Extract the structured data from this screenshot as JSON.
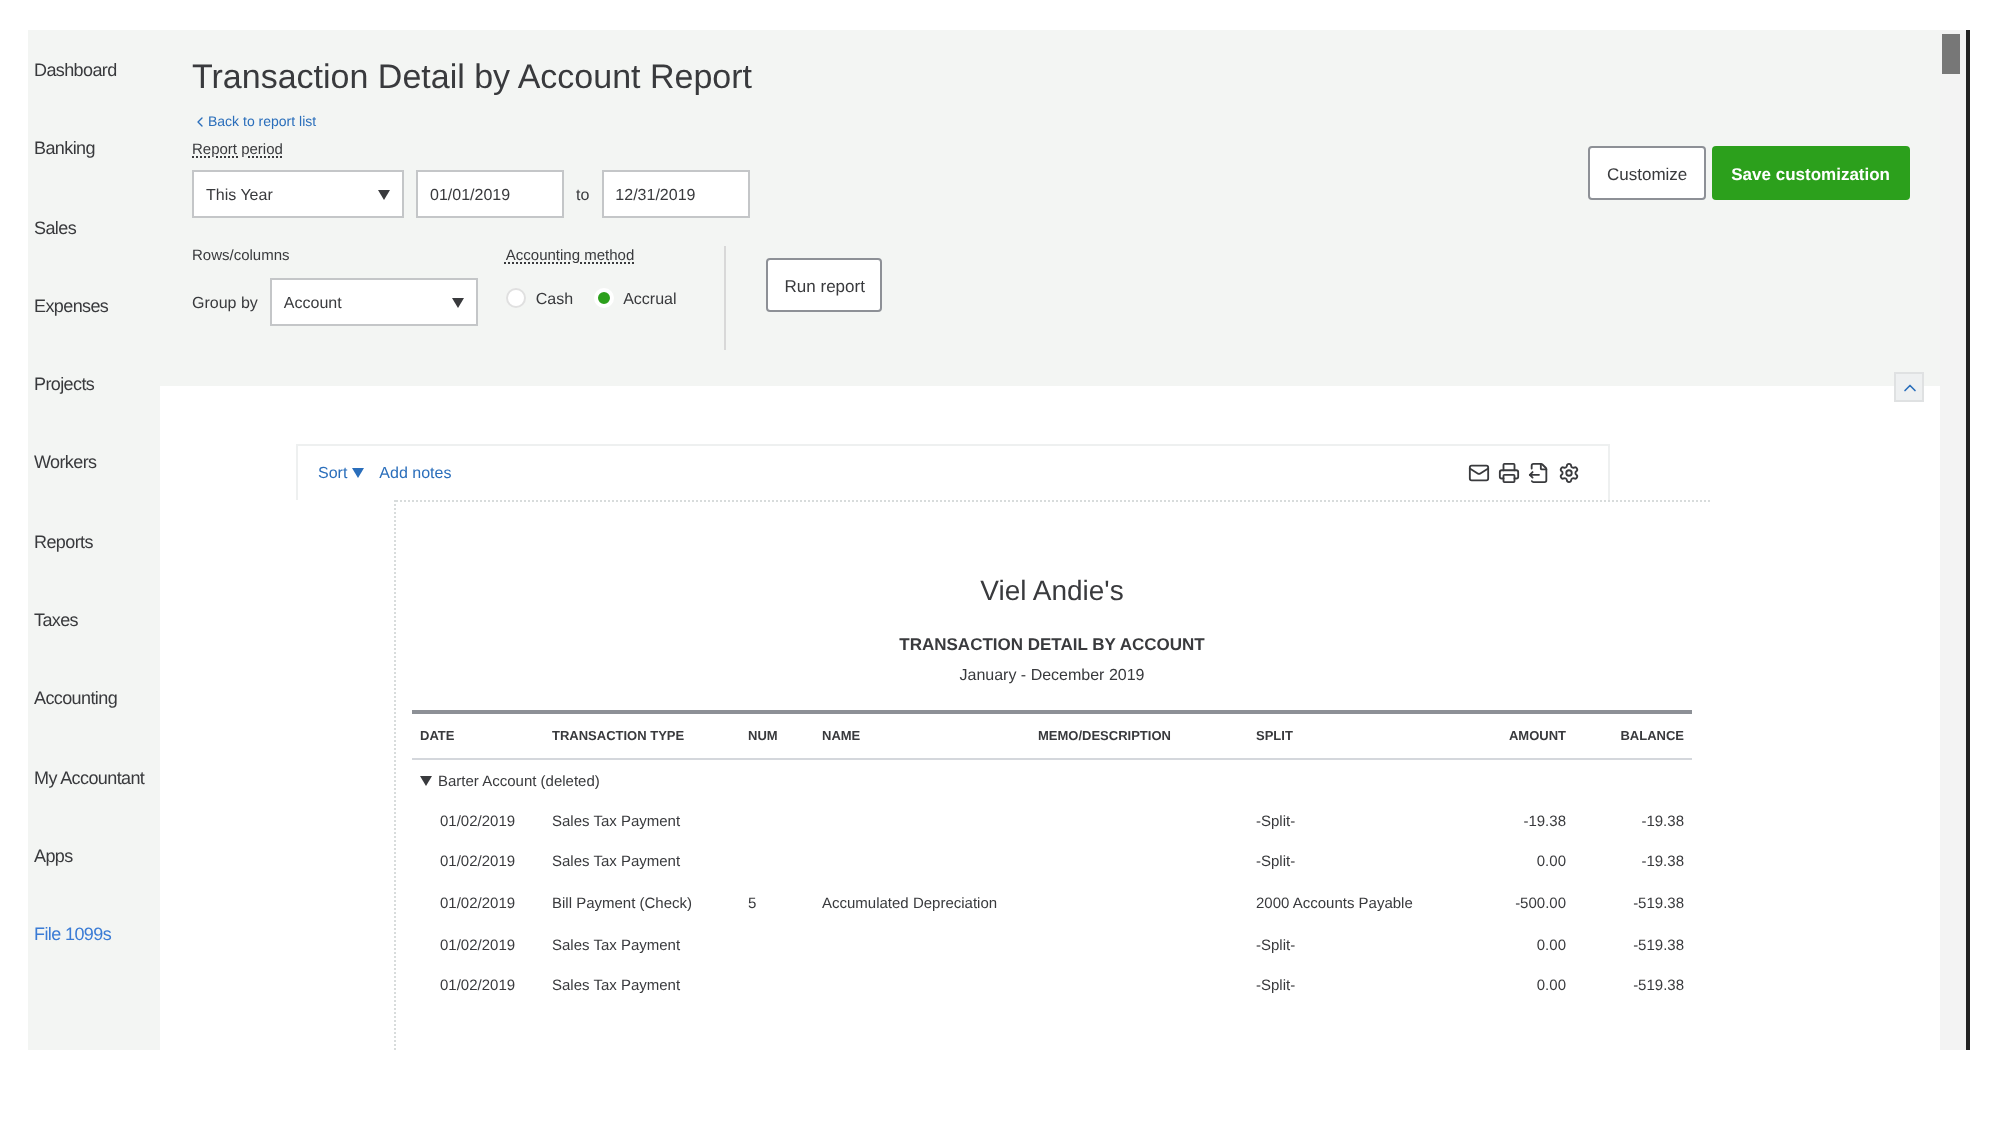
{
  "sidebar": {
    "items": [
      {
        "label": "Dashboard",
        "kind": "nav"
      },
      {
        "label": "Banking",
        "kind": "nav"
      },
      {
        "label": "Sales",
        "kind": "nav"
      },
      {
        "label": "Expenses",
        "kind": "nav"
      },
      {
        "label": "Projects",
        "kind": "nav"
      },
      {
        "label": "Workers",
        "kind": "nav"
      },
      {
        "label": "Reports",
        "kind": "nav"
      },
      {
        "label": "Taxes",
        "kind": "nav"
      },
      {
        "label": "Accounting",
        "kind": "nav"
      },
      {
        "label": "My Accountant",
        "kind": "nav"
      },
      {
        "label": "Apps",
        "kind": "nav"
      },
      {
        "label": "File 1099s",
        "kind": "link"
      }
    ]
  },
  "header": {
    "title": "Transaction Detail by Account Report",
    "back_link": "Back to report list",
    "report_period": {
      "label": "Report period",
      "value": "This Year",
      "from": "01/01/2019",
      "to_label": "to",
      "to": "12/31/2019"
    },
    "rows_columns": {
      "label": "Rows/columns",
      "group_by_label": "Group by",
      "group_by": "Account"
    },
    "accounting_method": {
      "label": "Accounting method",
      "options": [
        {
          "label": "Cash",
          "selected": false
        },
        {
          "label": "Accrual",
          "selected": true
        }
      ]
    },
    "run_button": "Run report",
    "customize_button": "Customize",
    "save_button": "Save customization"
  },
  "toolbar": {
    "sort": "Sort",
    "add_notes": "Add notes"
  },
  "report": {
    "company": "Viel Andie's",
    "title": "TRANSACTION DETAIL BY ACCOUNT",
    "period": "January - December 2019",
    "columns": [
      "DATE",
      "TRANSACTION TYPE",
      "NUM",
      "NAME",
      "MEMO/DESCRIPTION",
      "SPLIT",
      "AMOUNT",
      "BALANCE"
    ],
    "group": {
      "label": "Barter Account (deleted)",
      "expanded": true
    },
    "rows": [
      [
        "01/02/2019",
        "Sales Tax Payment",
        "",
        "",
        "",
        "-Split-",
        "-19.38",
        "-19.38"
      ],
      [
        "01/02/2019",
        "Sales Tax Payment",
        "",
        "",
        "",
        "-Split-",
        "0.00",
        "-19.38"
      ],
      [
        "01/02/2019",
        "Bill Payment (Check)",
        "5",
        "Accumulated Depreciation",
        "",
        "2000 Accounts Payable",
        "-500.00",
        "-519.38"
      ],
      [
        "01/02/2019",
        "Sales Tax Payment",
        "",
        "",
        "",
        "-Split-",
        "0.00",
        "-519.38"
      ],
      [
        "01/02/2019",
        "Sales Tax Payment",
        "",
        "",
        "",
        "-Split-",
        "0.00",
        "-519.38"
      ]
    ]
  }
}
